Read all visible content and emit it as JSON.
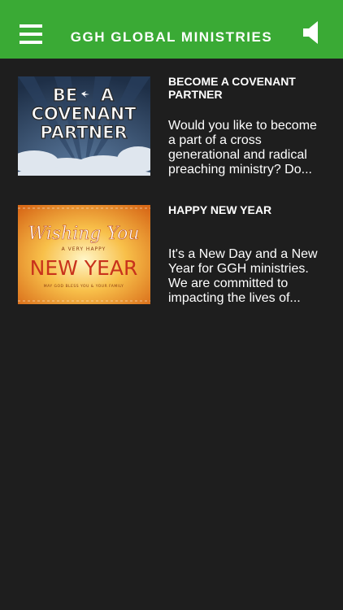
{
  "header": {
    "title": "GGH GLOBAL MINISTRIES",
    "menu_icon": "hamburger-menu-icon",
    "sound_icon": "speaker-icon",
    "color": "#3aaa35"
  },
  "posts": [
    {
      "title": "BECOME A COVENANT PARTNER",
      "description": "Would you like to become a part of a cross generational and radical preaching ministry? Do...",
      "image": {
        "line1_left": "BE",
        "line1_right": "A",
        "line2": "COVENANT",
        "line3": "PARTNER"
      }
    },
    {
      "title": "HAPPY NEW YEAR",
      "description": "It's a New Day and a New Year for GGH ministries. We are committed to impacting the lives of...",
      "image": {
        "script": "Wishing You",
        "banner": "A VERY HAPPY",
        "big": "NEW YEAR",
        "small": "MAY GOD BLESS YOU & YOUR FAMILY"
      }
    }
  ]
}
